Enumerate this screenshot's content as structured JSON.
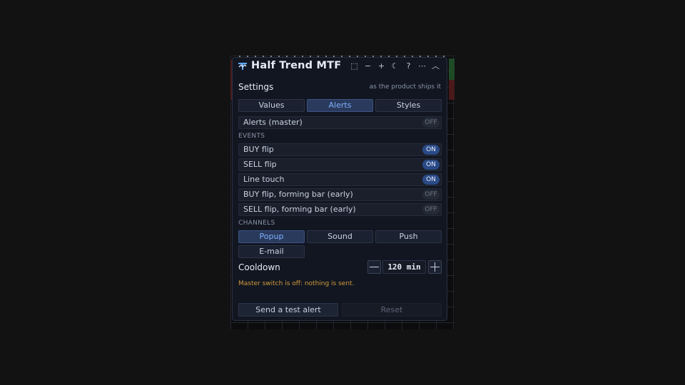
{
  "panel": {
    "title": "Half Trend MTF",
    "logo_icon": "half-trend-logo-icon",
    "toolbar_icons": [
      "chat-bubble-off-icon",
      "minus-icon",
      "plus-icon",
      "moon-icon",
      "help-icon",
      "more-icon",
      "chevron-up-icon"
    ],
    "toolbar_glyphs": [
      "⬚",
      "−",
      "+",
      "☾",
      "?",
      "⋯",
      "︿"
    ]
  },
  "settings": {
    "label": "Settings",
    "subtitle": "as the product ships it"
  },
  "tabs": [
    {
      "label": "Values",
      "active": false
    },
    {
      "label": "Alerts",
      "active": true
    },
    {
      "label": "Styles",
      "active": false
    }
  ],
  "master": {
    "label": "Alerts (master)",
    "state": "OFF"
  },
  "events_header": "EVENTS",
  "events": [
    {
      "label": "BUY flip",
      "state": "ON"
    },
    {
      "label": "SELL flip",
      "state": "ON"
    },
    {
      "label": "Line touch",
      "state": "ON"
    },
    {
      "label": "BUY flip, forming bar (early)",
      "state": "OFF"
    },
    {
      "label": "SELL flip, forming bar (early)",
      "state": "OFF"
    }
  ],
  "channels_header": "CHANNELS",
  "channels": [
    {
      "label": "Popup",
      "active": true
    },
    {
      "label": "Sound",
      "active": false
    },
    {
      "label": "Push",
      "active": false
    }
  ],
  "email_label": "E-mail",
  "cooldown": {
    "label": "Cooldown",
    "value": "120 min"
  },
  "warning": "Master switch is off: nothing is sent.",
  "buttons": {
    "send_test": "Send a test alert",
    "reset": "Reset"
  },
  "colors": {
    "accent": "#7fb0ff",
    "warning": "#d39a3c",
    "on_pill": "#2a4a86",
    "panel_bg": "#111621"
  }
}
